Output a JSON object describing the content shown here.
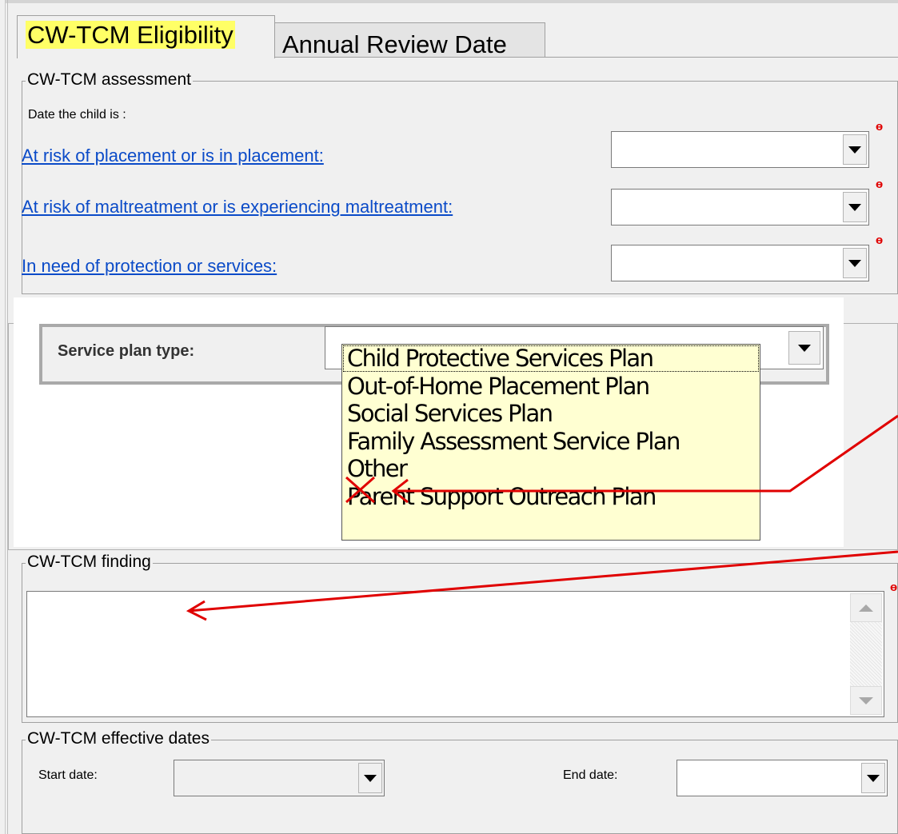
{
  "tabs": [
    {
      "label": "CW-TCM Eligibility",
      "active": true,
      "highlight": "#ffff66"
    },
    {
      "label": "Annual Review Date",
      "active": false
    }
  ],
  "assessment": {
    "title": "CW-TCM assessment",
    "intro": "Date the child is :",
    "rows": [
      {
        "label": "At risk of placement or is in placement:",
        "value": "",
        "required": true
      },
      {
        "label": "At risk of maltreatment or is experiencing maltreatment:",
        "value": "",
        "required": true
      },
      {
        "label": "In need of protection or services:",
        "value": "",
        "required": true
      }
    ]
  },
  "service_plan": {
    "label": "Service plan type:",
    "value": "",
    "options": [
      {
        "label": "Child Protective Services Plan",
        "focused": true,
        "crossed_out": false
      },
      {
        "label": "Out-of-Home Placement Plan",
        "focused": false,
        "crossed_out": false
      },
      {
        "label": "Social Services Plan",
        "focused": false,
        "crossed_out": false
      },
      {
        "label": "Family Assessment Service Plan",
        "focused": false,
        "crossed_out": false
      },
      {
        "label": "Other",
        "focused": false,
        "crossed_out": true
      },
      {
        "label": "Parent Support Outreach Plan",
        "focused": false,
        "crossed_out": false
      }
    ]
  },
  "finding": {
    "title": "CW-TCM finding",
    "value": "",
    "required": true
  },
  "effective_dates": {
    "title": "CW-TCM effective dates",
    "start_label": "Start date:",
    "start_value": "",
    "start_enabled": false,
    "end_label": "End date:",
    "end_value": ""
  },
  "required_marker": "ө",
  "colors": {
    "link": "#0b4bc8",
    "required": "#e00000",
    "annotation": "#e00000",
    "dropdown_bg": "#ffffd2",
    "tab_highlight": "#ffff66"
  }
}
